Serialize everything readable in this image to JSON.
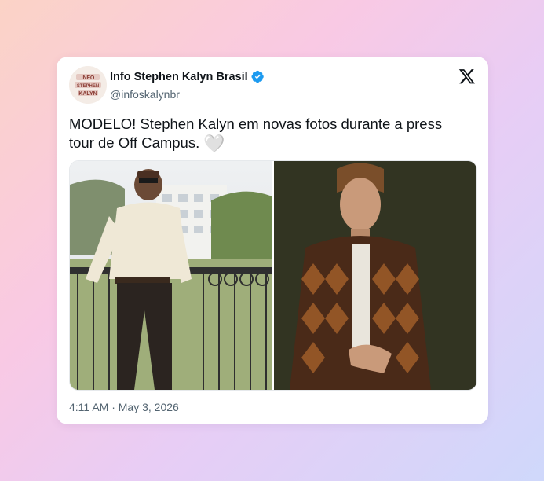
{
  "account": {
    "display_name": "Info Stephen Kalyn Brasil",
    "handle": "@infoskalynbr",
    "avatar_text": [
      "INFO",
      "STEPHEN",
      "KALYN"
    ],
    "verified": true
  },
  "tweet": {
    "text": "MODELO! Stephen Kalyn em novas fotos durante a press tour de Off Campus.",
    "emoji": "🤍",
    "timestamp": "4:11 AM · May 3, 2026"
  },
  "media": [
    {
      "description_icon": "photo-balcony"
    },
    {
      "description_icon": "photo-dark-portrait"
    }
  ],
  "colors": {
    "verified_blue": "#1d9bf0",
    "text_primary": "#0f1419",
    "text_secondary": "#536471"
  },
  "icons": {
    "brand": "x-logo-icon",
    "verified": "verified-badge-icon"
  }
}
